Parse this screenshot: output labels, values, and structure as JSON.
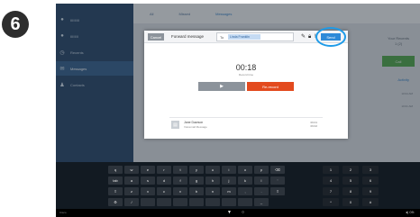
{
  "step_number": "6",
  "sidebar": {
    "top_items": [
      {
        "icon": "chat-icon",
        "label": "IIIIIIIII"
      },
      {
        "icon": "chat-icon",
        "label": "IIIIIIII"
      }
    ],
    "items": [
      {
        "icon": "clock-icon",
        "label": "Recents"
      },
      {
        "icon": "envelope-icon",
        "label": "Messages"
      },
      {
        "icon": "person-icon",
        "label": "Contacts"
      }
    ]
  },
  "main": {
    "tabs": [
      "All",
      "Missed",
      "Messages"
    ],
    "right_panel_title": "Your Recents",
    "right_panel_sub": "1 (2)",
    "green_block_label": "Call",
    "right_tab": "Activity",
    "meta_1": "10:04 AM",
    "meta_2": "10:01 AM"
  },
  "dialog": {
    "cancel_label": "Cancel",
    "title": "Forward message",
    "to_label": "To",
    "recipient": "Linda Franklin",
    "send_label": "Send",
    "timer": "00:18",
    "timer_sub": "Record time",
    "play_symbol": "▶",
    "rerecord_label": "Re-record",
    "recipient_row": {
      "name": "Jane Dawson",
      "sub": "Voicemail Message",
      "time": "09:01",
      "date": "09:02"
    }
  },
  "keyboard": {
    "row1": [
      "q",
      "w",
      "e",
      "r",
      "t",
      "y",
      "u",
      "i",
      "o",
      "p",
      "⌫"
    ],
    "row2": [
      "tab",
      "a",
      "s",
      "d",
      "f",
      "g",
      "h",
      "j",
      "k",
      "l",
      "'"
    ],
    "row3": [
      "⇧",
      "z",
      "x",
      "c",
      "v",
      "b",
      "n",
      "m",
      ",",
      ".",
      "⇧"
    ],
    "row4": [
      "⚙",
      "/",
      "",
      "",
      "",
      "",
      "",
      "",
      "",
      "_"
    ],
    "numpad": [
      [
        "1",
        "2",
        "3"
      ],
      [
        "4",
        "5",
        "6"
      ],
      [
        "7",
        "8",
        "9"
      ],
      [
        "*",
        "0",
        "#"
      ]
    ]
  },
  "system_bar": {
    "left": "Cisco",
    "back": "▼",
    "home": "○",
    "right": "◂) 09:"
  },
  "colors": {
    "sidebar": "#1f3f63",
    "send": "#2e8ad8",
    "rerecord": "#e34a1e",
    "highlight_ring": "#1e9be8",
    "green": "#4aa344"
  }
}
